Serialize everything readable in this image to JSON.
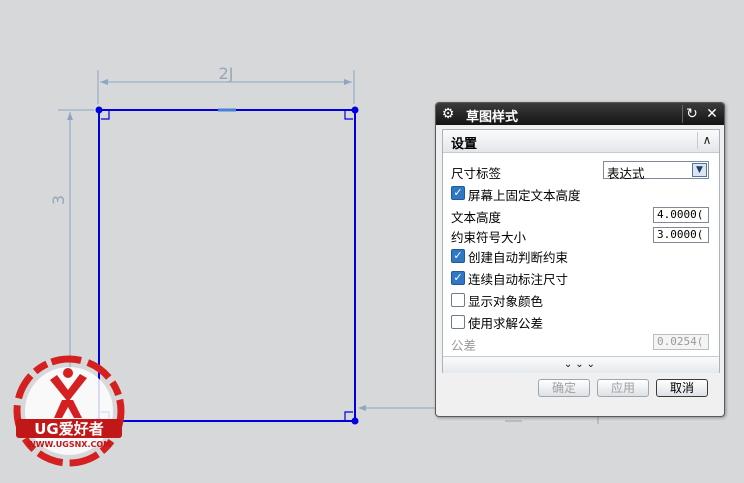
{
  "canvas": {
    "horizontal_dimension": "2J",
    "vertical_dimension": "3"
  },
  "dialog": {
    "title": "草图样式",
    "section_title": "设置",
    "dimension_label": {
      "label": "尺寸标签",
      "selected": "表达式"
    },
    "fixed_text_height": {
      "label": "屏幕上固定文本高度",
      "checked": true
    },
    "text_height": {
      "label": "文本高度",
      "value": "4.0000("
    },
    "constraint_symbol_size": {
      "label": "约束符号大小",
      "value": "3.0000("
    },
    "auto_infer_constraints": {
      "label": "创建自动判断约束",
      "checked": true
    },
    "continuous_auto_dimension": {
      "label": "连续自动标注尺寸",
      "checked": true
    },
    "show_object_color": {
      "label": "显示对象颜色",
      "checked": false
    },
    "use_solver_tolerance": {
      "label": "使用求解公差",
      "checked": false
    },
    "tolerance": {
      "label": "公差",
      "value": "0.0254("
    },
    "more_glyph": "⌄⌄⌄",
    "buttons": {
      "ok": "确定",
      "apply": "应用",
      "cancel": "取消"
    },
    "icons": {
      "settings": "gear-icon",
      "reset": "reset-icon",
      "close": "close-icon",
      "collapse": "chevron-up-icon",
      "dropdown": "chevron-down-icon"
    }
  },
  "watermark": {
    "brand": "UG爱好者",
    "url": "WWW.UGSNX.COM"
  },
  "colors": {
    "sketch_line": "#0000dd",
    "dimension_line": "#8fa6c2",
    "checkbox_accent": "#2f78c4",
    "logo_red": "#d42020"
  }
}
